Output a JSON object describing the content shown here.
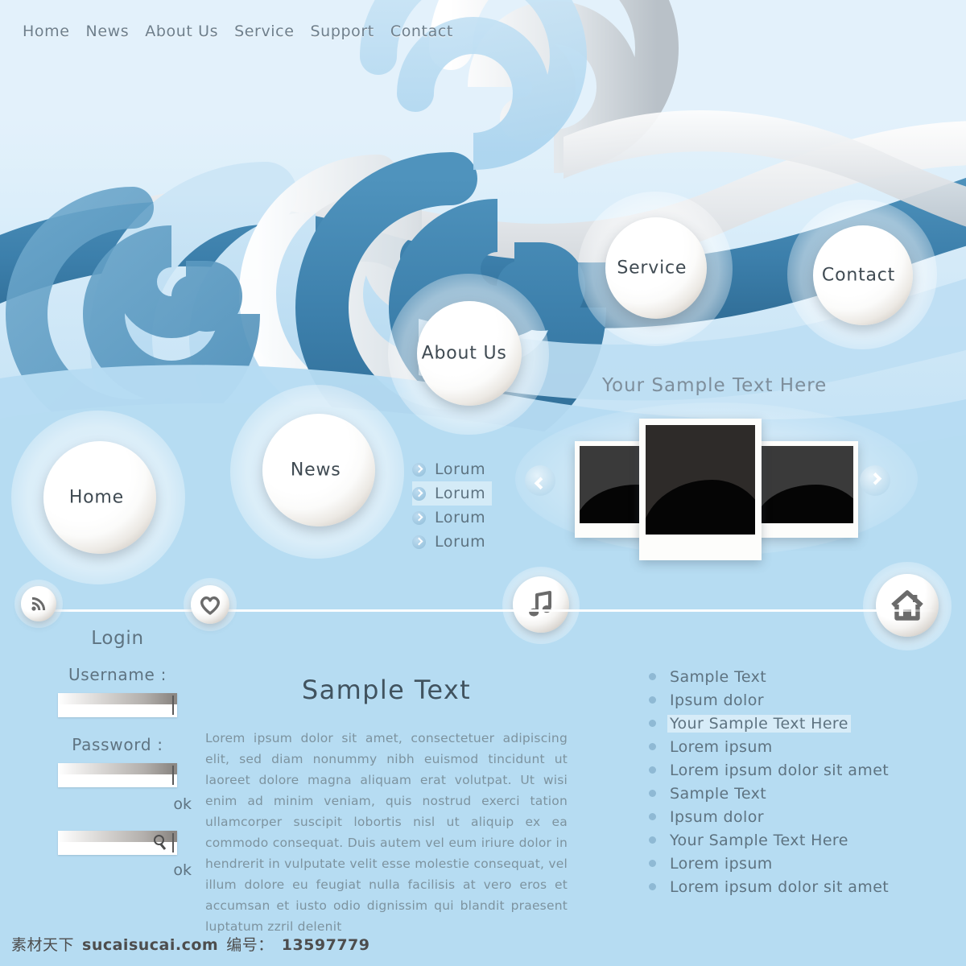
{
  "theme": {
    "bg_top": "#e3f1fb",
    "bg_bottom": "#b6dcf2",
    "wave_blue_dark": "#3c7fab",
    "wave_blue_mid": "#5a9cc4",
    "wave_blue_light": "#bddef3",
    "wave_grey": "#d8dde1",
    "text_muted": "#5e7381",
    "text_body": "#7d939f",
    "bullet": "#8fb9d4"
  },
  "topnav": {
    "items": [
      {
        "label": "Home"
      },
      {
        "label": "News"
      },
      {
        "label": "About Us"
      },
      {
        "label": "Service"
      },
      {
        "label": "Support"
      },
      {
        "label": "Contact"
      }
    ]
  },
  "bubbles": {
    "home": "Home",
    "news": "News",
    "about": "About Us",
    "service": "Service",
    "contact": "Contact"
  },
  "hero": {
    "caption": "Your Sample Text Here"
  },
  "lorum_list": {
    "items": [
      {
        "label": "Lorum",
        "highlighted": false
      },
      {
        "label": "Lorum",
        "highlighted": true
      },
      {
        "label": "Lorum",
        "highlighted": false
      },
      {
        "label": "Lorum",
        "highlighted": false
      }
    ]
  },
  "carousel": {
    "prev_icon": "chevron-left-icon",
    "next_icon": "chevron-right-icon",
    "slides": [
      {
        "position": "left"
      },
      {
        "position": "center"
      },
      {
        "position": "right"
      }
    ]
  },
  "rail": {
    "icons": [
      {
        "name": "rss-icon"
      },
      {
        "name": "heart-icon"
      },
      {
        "name": "music-note-icon"
      },
      {
        "name": "home-icon"
      }
    ]
  },
  "login": {
    "title": "Login",
    "username_label": "Username :",
    "username_value": "",
    "username_placeholder": "",
    "password_label": "Password :",
    "password_value": "",
    "password_placeholder": "",
    "ok_label": "ok",
    "search_value": "",
    "search_placeholder": "",
    "search_icon": "magnifier-icon",
    "search_ok_label": "ok"
  },
  "article": {
    "title": "Sample Text",
    "body": "Lorem ipsum dolor sit amet, consectetuer adipiscing elit, sed diam nonummy nibh euismod tincidunt ut laoreet dolore magna aliquam erat volutpat. Ut wisi enim ad minim veniam, quis nostrud exerci tation ullamcorper suscipit lobortis nisl ut aliquip ex ea commodo consequat. Duis autem vel eum iriure dolor in hendrerit in vulputate velit esse molestie consequat, vel illum dolore eu feugiat nulla facilisis at vero eros et accumsan et iusto odio dignissim qui blandit praesent luptatum zzril delenit"
  },
  "right_list": {
    "items": [
      {
        "label": "Sample Text",
        "highlighted": false
      },
      {
        "label": "Ipsum dolor",
        "highlighted": false
      },
      {
        "label": "Your Sample Text Here",
        "highlighted": true
      },
      {
        "label": "Lorem ipsum",
        "highlighted": false
      },
      {
        "label": "Lorem ipsum dolor sit amet",
        "highlighted": false
      },
      {
        "label": "Sample Text",
        "highlighted": false
      },
      {
        "label": "Ipsum dolor",
        "highlighted": false
      },
      {
        "label": "Your Sample Text Here",
        "highlighted": false
      },
      {
        "label": "Lorem ipsum",
        "highlighted": false
      },
      {
        "label": "Lorem ipsum dolor sit amet",
        "highlighted": false
      }
    ]
  },
  "footer": {
    "site_cn": "素材天下",
    "site_domain": "sucaisucai.com",
    "id_label": "编号：",
    "id_value": "13597779"
  }
}
